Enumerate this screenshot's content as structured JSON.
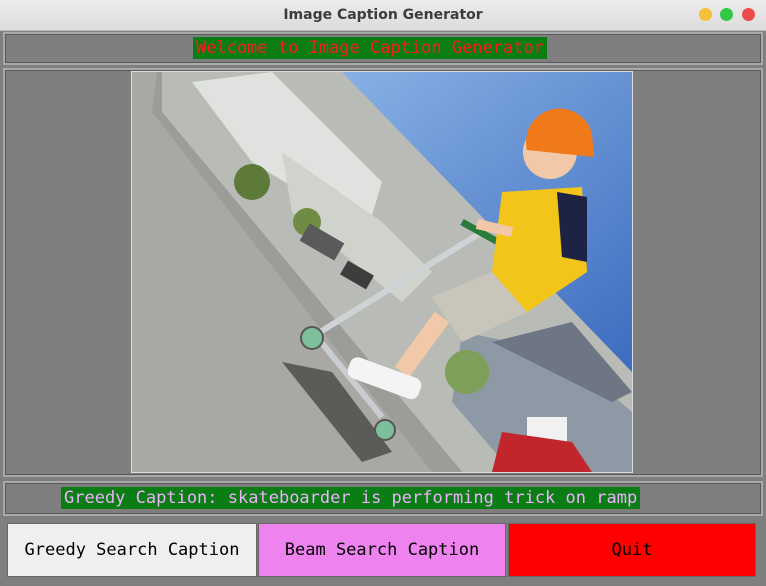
{
  "window": {
    "title": "Image Caption Generator"
  },
  "header": {
    "welcome": "Welcome to Image Caption Generator",
    "colors": {
      "background": "#0a7d14",
      "text": "#ff1a1a"
    }
  },
  "caption": {
    "label": "Greedy Caption:",
    "text": "skateboarder is performing trick on ramp",
    "colors": {
      "background": "#0a7d14",
      "text": "#f0b0ff"
    }
  },
  "buttons": {
    "greedy": "Greedy Search Caption",
    "beam": "Beam Search Caption",
    "quit": "Quit"
  },
  "button_colors": {
    "greedy": "#efefef",
    "beam": "#ee82ee",
    "quit": "#ff0000"
  },
  "window_controls": [
    "minimize-icon",
    "maximize-icon",
    "close-icon"
  ]
}
